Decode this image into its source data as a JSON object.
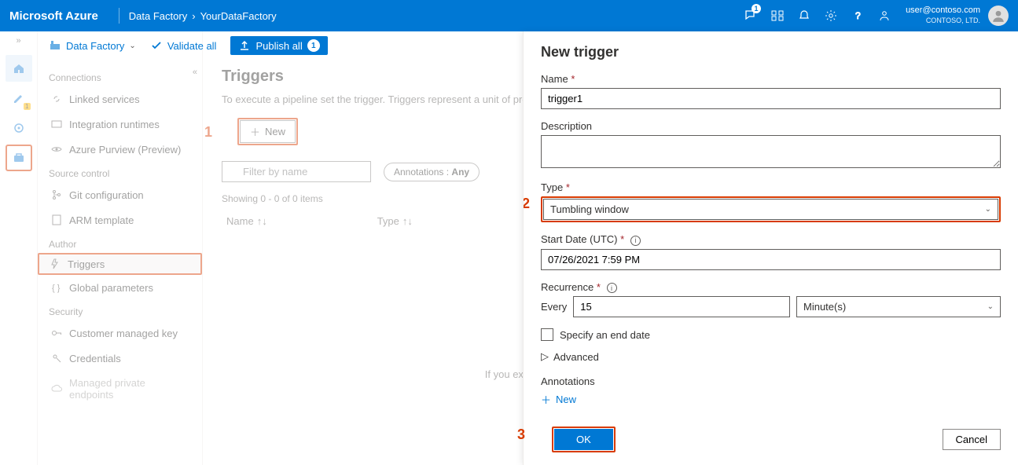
{
  "topbar": {
    "brand": "Microsoft Azure",
    "crumb1": "Data Factory",
    "crumb2": "YourDataFactory",
    "notif_badge": "1",
    "user_email": "user@contoso.com",
    "user_org": "CONTOSO, LTD."
  },
  "leftrail": {
    "pencil_badge": "1"
  },
  "cmdbar": {
    "factory_label": "Data Factory",
    "validate_label": "Validate all",
    "publish_label": "Publish all",
    "publish_count": "1"
  },
  "sidebar": {
    "sections": {
      "connections": "Connections",
      "source_control": "Source control",
      "author": "Author",
      "security": "Security"
    },
    "items": {
      "linked_services": "Linked services",
      "integration_runtimes": "Integration runtimes",
      "azure_purview": "Azure Purview (Preview)",
      "git_config": "Git configuration",
      "arm_template": "ARM template",
      "triggers": "Triggers",
      "global_params": "Global parameters",
      "cmk": "Customer managed key",
      "credentials": "Credentials",
      "mpe": "Managed private endpoints"
    }
  },
  "main": {
    "title": "Triggers",
    "subtitle": "To execute a pipeline set the trigger. Triggers represent a unit of processing.",
    "new_label": "New",
    "filter_placeholder": "Filter by name",
    "annotations_label": "Annotations :",
    "annotations_value": "Any",
    "showing": "Showing 0 - 0 of 0 items",
    "col_name": "Name",
    "col_type": "Type",
    "empty_text": "If you expected to see triggers here, try adjusting filters.",
    "step1": "1"
  },
  "panel": {
    "title": "New trigger",
    "name_label": "Name",
    "name_value": "trigger1",
    "desc_label": "Description",
    "desc_value": "",
    "type_label": "Type",
    "type_value": "Tumbling window",
    "start_label": "Start Date (UTC)",
    "start_value": "07/26/2021 7:59 PM",
    "recur_label": "Recurrence",
    "every_label": "Every",
    "every_value": "15",
    "unit_value": "Minute(s)",
    "end_date_label": "Specify an end date",
    "advanced_label": "Advanced",
    "annotations_label": "Annotations",
    "ann_new_label": "New",
    "ok_label": "OK",
    "cancel_label": "Cancel",
    "step2": "2",
    "step3": "3"
  }
}
